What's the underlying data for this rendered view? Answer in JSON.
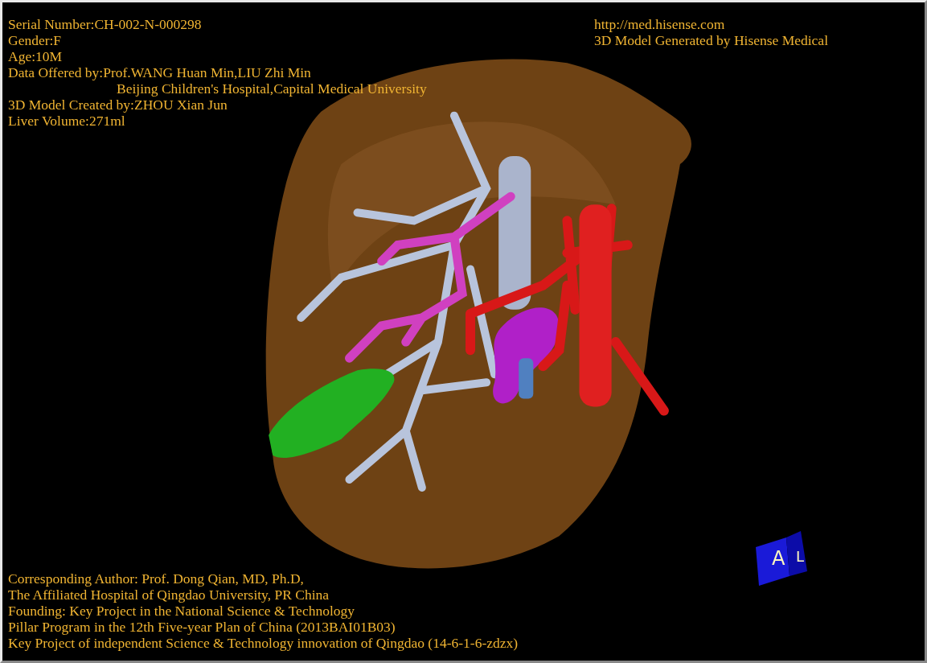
{
  "patient_info": [
    {
      "text": "Serial Number:CH-002-N-000298",
      "continuation": false
    },
    {
      "text": "Gender:F",
      "continuation": false
    },
    {
      "text": "Age:10M",
      "continuation": false
    },
    {
      "text": "Data Offered by:Prof.WANG Huan Min,LIU Zhi Min",
      "continuation": false
    },
    {
      "text": "Beijing Children's Hospital,Capital Medical University",
      "continuation": true
    },
    {
      "text": "3D Model Created by:ZHOU Xian Jun",
      "continuation": false
    },
    {
      "text": "Liver Volume:271ml",
      "continuation": false
    }
  ],
  "producer_info": {
    "url": "http://med.hisense.com",
    "generator": "3D Model Generated by Hisense Medical"
  },
  "orientation_cube": {
    "front_label": "A",
    "side_label": "L"
  },
  "credits": [
    "Corresponding Author: Prof. Dong Qian, MD, Ph.D,",
    "The Affiliated Hospital of Qingdao University, PR China",
    "Founding: Key Project in the National Science & Technology",
    "Pillar Program in the 12th Five-year Plan of China (2013BAI01B03)",
    "Key Project of independent Science & Technology innovation of Qingdao (14-6-1-6-zdzx)"
  ]
}
